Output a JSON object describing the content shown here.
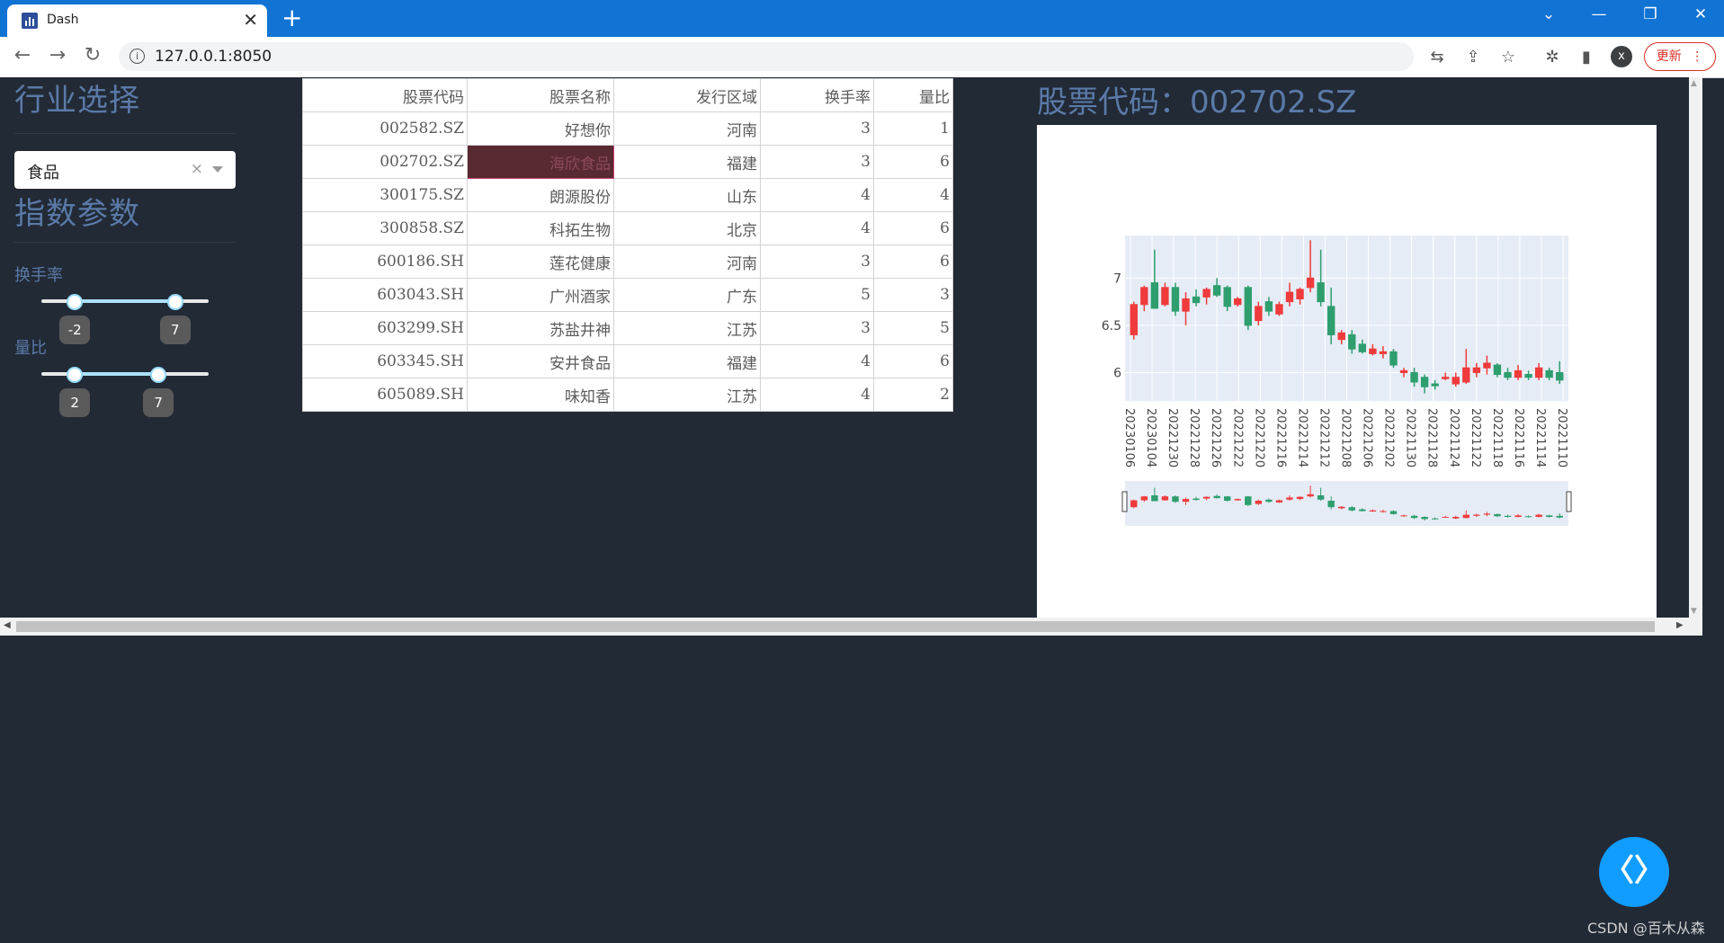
{
  "browser": {
    "tab_title": "Dash",
    "tab_close": "✕",
    "new_tab": "+",
    "url": "127.0.0.1:8050",
    "avatar_letter": "x",
    "update_label": "更新",
    "update_menu": "⋮",
    "window_controls": [
      "⌄",
      "—",
      "❐",
      "✕"
    ]
  },
  "sidebar": {
    "industry_title": "行业选择",
    "industry_dropdown": {
      "value": "食品",
      "clear": "×"
    },
    "params_title": "指数参数",
    "turnover": {
      "label": "换手率",
      "min": -5,
      "max": 10,
      "low": -2,
      "high": 7
    },
    "volume_ratio": {
      "label": "量比",
      "min": 0,
      "max": 10,
      "low": 2,
      "high": 7
    }
  },
  "table": {
    "headers": [
      "股票代码",
      "股票名称",
      "发行区域",
      "换手率",
      "量比"
    ],
    "rows": [
      [
        "002582.SZ",
        "好想你",
        "河南",
        "3",
        "1"
      ],
      [
        "002702.SZ",
        "海欣食品",
        "福建",
        "3",
        "6"
      ],
      [
        "300175.SZ",
        "朗源股份",
        "山东",
        "4",
        "4"
      ],
      [
        "300858.SZ",
        "科拓生物",
        "北京",
        "4",
        "6"
      ],
      [
        "600186.SH",
        "莲花健康",
        "河南",
        "3",
        "6"
      ],
      [
        "603043.SH",
        "广州酒家",
        "广东",
        "5",
        "3"
      ],
      [
        "603299.SH",
        "苏盐井神",
        "江苏",
        "3",
        "5"
      ],
      [
        "603345.SH",
        "安井食品",
        "福建",
        "4",
        "6"
      ],
      [
        "605089.SH",
        "味知香",
        "江苏",
        "4",
        "2"
      ]
    ],
    "selected": {
      "row": 1,
      "col": 1
    }
  },
  "chart": {
    "title": "股票代码：002702.SZ",
    "colors": {
      "up": "#ef3b3b",
      "down": "#2e9e6e",
      "plot_bg": "#e5ecf6",
      "grid": "#ffffff",
      "tick": "#444444"
    }
  },
  "chart_data": {
    "type": "candlestick",
    "ylim": [
      5.7,
      7.45
    ],
    "yticks": [
      6,
      6.5,
      7
    ],
    "xtick_labels": [
      "20230106",
      "20230104",
      "20221230",
      "20221228",
      "20221226",
      "20221222",
      "20221220",
      "20221216",
      "20221214",
      "20221212",
      "20221208",
      "20221206",
      "20221202",
      "20221130",
      "20221128",
      "20221124",
      "20221122",
      "20221118",
      "20221116",
      "20221114",
      "20221110"
    ],
    "candles": [
      {
        "o": 6.4,
        "h": 6.75,
        "l": 6.35,
        "c": 6.72
      },
      {
        "o": 6.72,
        "h": 6.92,
        "l": 6.65,
        "c": 6.9
      },
      {
        "o": 6.95,
        "h": 7.3,
        "l": 6.7,
        "c": 6.68
      },
      {
        "o": 6.72,
        "h": 6.95,
        "l": 6.7,
        "c": 6.9
      },
      {
        "o": 6.9,
        "h": 6.95,
        "l": 6.6,
        "c": 6.65
      },
      {
        "o": 6.65,
        "h": 6.85,
        "l": 6.5,
        "c": 6.78
      },
      {
        "o": 6.8,
        "h": 6.88,
        "l": 6.7,
        "c": 6.74
      },
      {
        "o": 6.8,
        "h": 6.9,
        "l": 6.72,
        "c": 6.88
      },
      {
        "o": 6.92,
        "h": 7.0,
        "l": 6.8,
        "c": 6.82
      },
      {
        "o": 6.9,
        "h": 6.92,
        "l": 6.65,
        "c": 6.7
      },
      {
        "o": 6.72,
        "h": 6.8,
        "l": 6.7,
        "c": 6.78
      },
      {
        "o": 6.9,
        "h": 6.92,
        "l": 6.45,
        "c": 6.5
      },
      {
        "o": 6.55,
        "h": 6.75,
        "l": 6.5,
        "c": 6.7
      },
      {
        "o": 6.75,
        "h": 6.8,
        "l": 6.6,
        "c": 6.65
      },
      {
        "o": 6.62,
        "h": 6.75,
        "l": 6.6,
        "c": 6.72
      },
      {
        "o": 6.75,
        "h": 6.95,
        "l": 6.7,
        "c": 6.85
      },
      {
        "o": 6.78,
        "h": 6.9,
        "l": 6.72,
        "c": 6.88
      },
      {
        "o": 6.9,
        "h": 7.4,
        "l": 6.85,
        "c": 7.0
      },
      {
        "o": 6.95,
        "h": 7.3,
        "l": 6.7,
        "c": 6.75
      },
      {
        "o": 6.7,
        "h": 6.9,
        "l": 6.3,
        "c": 6.4
      },
      {
        "o": 6.35,
        "h": 6.45,
        "l": 6.3,
        "c": 6.42
      },
      {
        "o": 6.4,
        "h": 6.45,
        "l": 6.2,
        "c": 6.25
      },
      {
        "o": 6.3,
        "h": 6.35,
        "l": 6.2,
        "c": 6.22
      },
      {
        "o": 6.2,
        "h": 6.3,
        "l": 6.18,
        "c": 6.25
      },
      {
        "o": 6.2,
        "h": 6.28,
        "l": 6.15,
        "c": 6.22
      },
      {
        "o": 6.22,
        "h": 6.25,
        "l": 6.05,
        "c": 6.08
      },
      {
        "o": 6.0,
        "h": 6.05,
        "l": 5.95,
        "c": 6.02
      },
      {
        "o": 6.0,
        "h": 6.05,
        "l": 5.85,
        "c": 5.9
      },
      {
        "o": 5.95,
        "h": 5.98,
        "l": 5.78,
        "c": 5.85
      },
      {
        "o": 5.88,
        "h": 5.92,
        "l": 5.82,
        "c": 5.86
      },
      {
        "o": 5.95,
        "h": 6.0,
        "l": 5.92,
        "c": 5.95
      },
      {
        "o": 5.88,
        "h": 6.0,
        "l": 5.85,
        "c": 5.95
      },
      {
        "o": 5.9,
        "h": 6.25,
        "l": 5.88,
        "c": 6.05
      },
      {
        "o": 6.0,
        "h": 6.1,
        "l": 5.95,
        "c": 6.05
      },
      {
        "o": 6.05,
        "h": 6.18,
        "l": 5.98,
        "c": 6.1
      },
      {
        "o": 6.08,
        "h": 6.1,
        "l": 5.95,
        "c": 5.98
      },
      {
        "o": 6.0,
        "h": 6.05,
        "l": 5.92,
        "c": 5.95
      },
      {
        "o": 5.95,
        "h": 6.08,
        "l": 5.92,
        "c": 6.02
      },
      {
        "o": 5.98,
        "h": 6.02,
        "l": 5.92,
        "c": 5.95
      },
      {
        "o": 5.95,
        "h": 6.1,
        "l": 5.92,
        "c": 6.05
      },
      {
        "o": 6.02,
        "h": 6.05,
        "l": 5.92,
        "c": 5.95
      },
      {
        "o": 6.0,
        "h": 6.12,
        "l": 5.88,
        "c": 5.92
      }
    ]
  },
  "overlay": {
    "fab_icon": "〈〉",
    "watermark": "CSDN @百木从森"
  }
}
